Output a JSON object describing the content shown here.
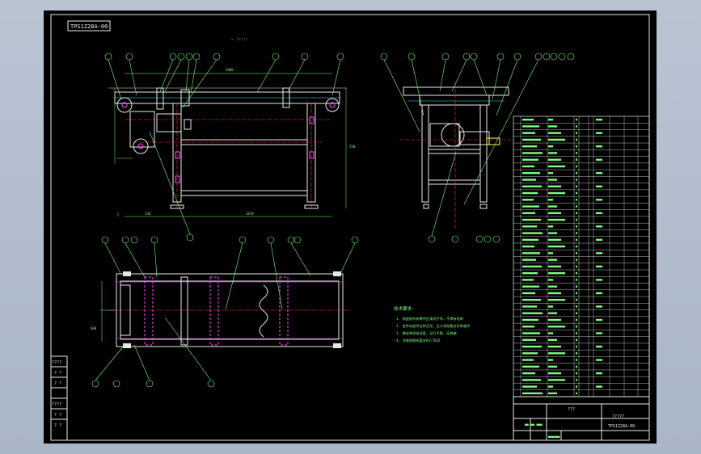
{
  "drawing": {
    "code_box": "TPS1Z28A-00",
    "top_mark": "— :::::",
    "notes_title": "技术要求:",
    "notes": [
      "1. 装配前所有零件应清洗干净，不得有毛刺",
      "2. 各传动部件运转灵活，无卡滞现象及异常噪声",
      "3. 输送带张紧适度，运行平稳，无跑偏",
      "4. 涂装按图纸要求Ral7035"
    ],
    "title_block": {
      "name": "???",
      "drawing_no": "TPS1Z28A-00",
      "company": "?????"
    },
    "left_strip": [
      "????",
      "? ?",
      "? ?",
      "????",
      "? ?",
      "? ?"
    ],
    "colors": {
      "frame": "#e8e8e8",
      "text": "#7dfc7d",
      "magenta": "#ff44ff",
      "red": "#ff3030",
      "cyan": "#39e6ff",
      "yellow": "#ffff50"
    }
  }
}
